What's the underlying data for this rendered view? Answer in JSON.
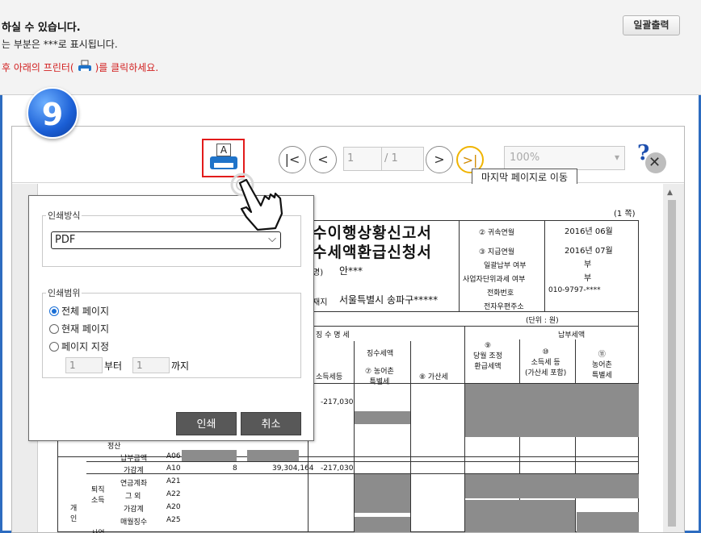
{
  "header": {
    "line1": "하실 수 있습니다.",
    "line2": "는 부분은   ***로 표시됩니다.",
    "line3_before": "후 아래의 프린터(",
    "line3_after": ")를 클릭하세요.",
    "print_all_label": "일괄출력"
  },
  "step_badge": "9",
  "toolbar": {
    "print_icon_letter": "A",
    "first_page": "|<",
    "prev_page": "<",
    "current_page": "1",
    "total_pages": "/ 1",
    "next_page": ">",
    "last_page": ">|",
    "zoom": "100%",
    "tooltip": "마지막 페이지로 이동",
    "help_icon": "?"
  },
  "document": {
    "page_label": "(1 쪽)",
    "title1": "수이행상황신고서",
    "title2": "수세액환급신청서",
    "rows": [
      {
        "label": "② 귀속연월",
        "value": "2016년 06월"
      },
      {
        "label": "③ 지급연월",
        "value": "2016년 07월"
      },
      {
        "label": "일괄납부 여부",
        "value": "부"
      },
      {
        "label": "사업자단위과세 여부",
        "value": "부"
      },
      {
        "label": "전화번호",
        "value": "010-9797-****"
      },
      {
        "label": "전자우편주소",
        "value": ""
      }
    ],
    "name_label": "명)",
    "name_value": "안***",
    "addr_label": "재지",
    "addr_value": "서울특별시 송파구*****",
    "unit": "(단위 : 원)",
    "sec_withholding": "징 수 명 세",
    "sec_taxamt": "징수세액",
    "sec_pay": "납부세액",
    "col_income": "소득세등",
    "col_rural": "⑦ 농어촌\n특별세",
    "col_add": "⑧ 가산세",
    "col_refund": "⑨\n당월 조정\n환급세액",
    "col_income2": "⑩\n소득세 등\n(가산세 포함)",
    "col_rural2": "⑪\n농어촌\n특별세",
    "row_values": [
      {
        "code": "A06",
        "label": "납부금액",
        "count": "",
        "amount": "",
        "tax": ""
      },
      {
        "code": "A10",
        "label": "가감계",
        "count": "8",
        "amount": "39,304,164",
        "tax": "-217,030"
      },
      {
        "code": "A21",
        "label": "연금계좌",
        "count": "",
        "amount": "",
        "tax": ""
      },
      {
        "code": "A22",
        "label": "그 외",
        "count": "",
        "amount": "",
        "tax": ""
      },
      {
        "code": "A20",
        "label": "가감계",
        "count": "",
        "amount": "",
        "tax": ""
      },
      {
        "code": "A25",
        "label": "매월징수",
        "count": "",
        "amount": "",
        "tax": ""
      }
    ],
    "upper_tax": "-217,030",
    "side_label_retire": "퇴직\n소득",
    "side_label_biz": "사업",
    "side_label_jeong": "정산",
    "side_label_person": "개\n인"
  },
  "print_dialog": {
    "method_legend": "인쇄방식",
    "method_value": "PDF",
    "range_legend": "인쇄범위",
    "options": [
      "전체 페이지",
      "현재 페이지",
      "페이지 지정"
    ],
    "selected_option": "전체 페이지",
    "from_value": "1",
    "from_label": "부터",
    "to_value": "1",
    "to_label": "까지",
    "print_button": "인쇄",
    "cancel_button": "취소"
  }
}
